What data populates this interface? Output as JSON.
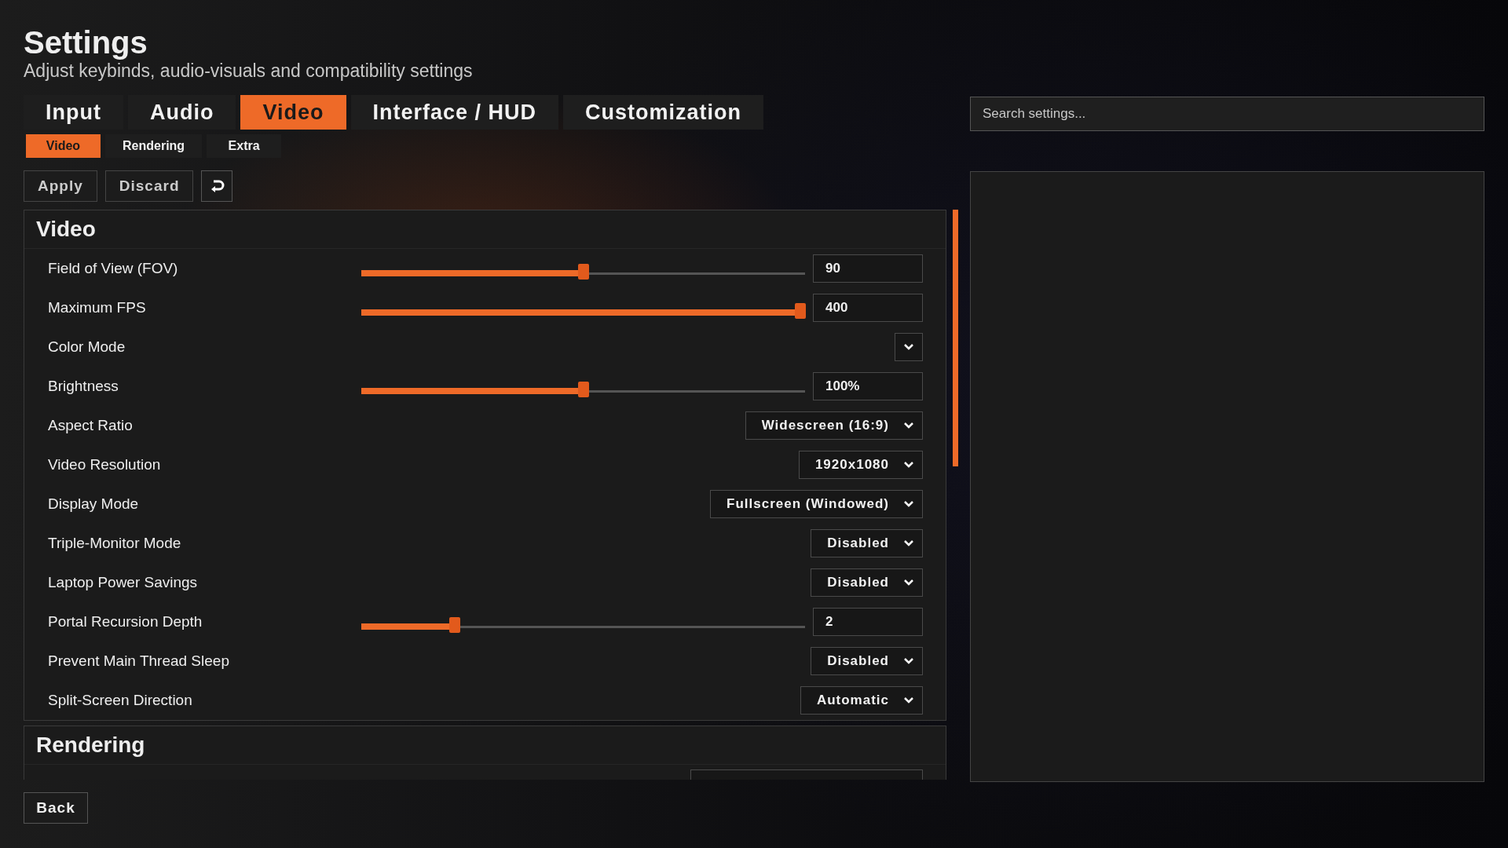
{
  "header": {
    "title": "Settings",
    "subtitle": "Adjust keybinds, audio-visuals and compatibility settings"
  },
  "tabs": [
    {
      "label": "Input",
      "selected": false
    },
    {
      "label": "Audio",
      "selected": false
    },
    {
      "label": "Video",
      "selected": true
    },
    {
      "label": "Interface / HUD",
      "selected": false
    },
    {
      "label": "Customization",
      "selected": false
    }
  ],
  "subtabs": [
    {
      "label": "Video",
      "selected": true
    },
    {
      "label": "Rendering",
      "selected": false
    },
    {
      "label": "Extra",
      "selected": false
    }
  ],
  "actions": [
    "Apply",
    "Discard"
  ],
  "sections": [
    {
      "title": "Video",
      "rows": [
        {
          "kind": "slider",
          "label": "Field of View (FOV)",
          "level": 0.5,
          "value": "90"
        },
        {
          "kind": "slider",
          "label": "Maximum FPS",
          "level": 0.99,
          "value": "400"
        },
        {
          "kind": "dropdown",
          "label": "Color Mode"
        },
        {
          "kind": "slider",
          "label": "Brightness",
          "level": 0.5,
          "value": "100%"
        },
        {
          "kind": "dropdown",
          "label": "Aspect Ratio",
          "value": "Widescreen (16:9)"
        },
        {
          "kind": "dropdown",
          "label": "Video Resolution",
          "value": "1920x1080"
        },
        {
          "kind": "dropdown",
          "label": "Display Mode",
          "value": "Fullscreen (Windowed)"
        },
        {
          "kind": "dropdown",
          "label": "Triple-Monitor Mode",
          "value": "Disabled"
        },
        {
          "kind": "dropdown",
          "label": "Laptop Power Savings",
          "value": "Disabled"
        },
        {
          "kind": "slider",
          "label": "Portal Recursion Depth",
          "level": 0.21,
          "value": "2"
        },
        {
          "kind": "dropdown",
          "label": "Prevent Main Thread Sleep",
          "value": "Disabled"
        },
        {
          "kind": "dropdown",
          "label": "Split-Screen Direction",
          "value": "Automatic"
        }
      ]
    },
    {
      "title": "Rendering",
      "rows": [
        {
          "kind": "dropdown"
        }
      ]
    }
  ],
  "search": {
    "placeholder": "Search settings..."
  },
  "back_button": "Back"
}
